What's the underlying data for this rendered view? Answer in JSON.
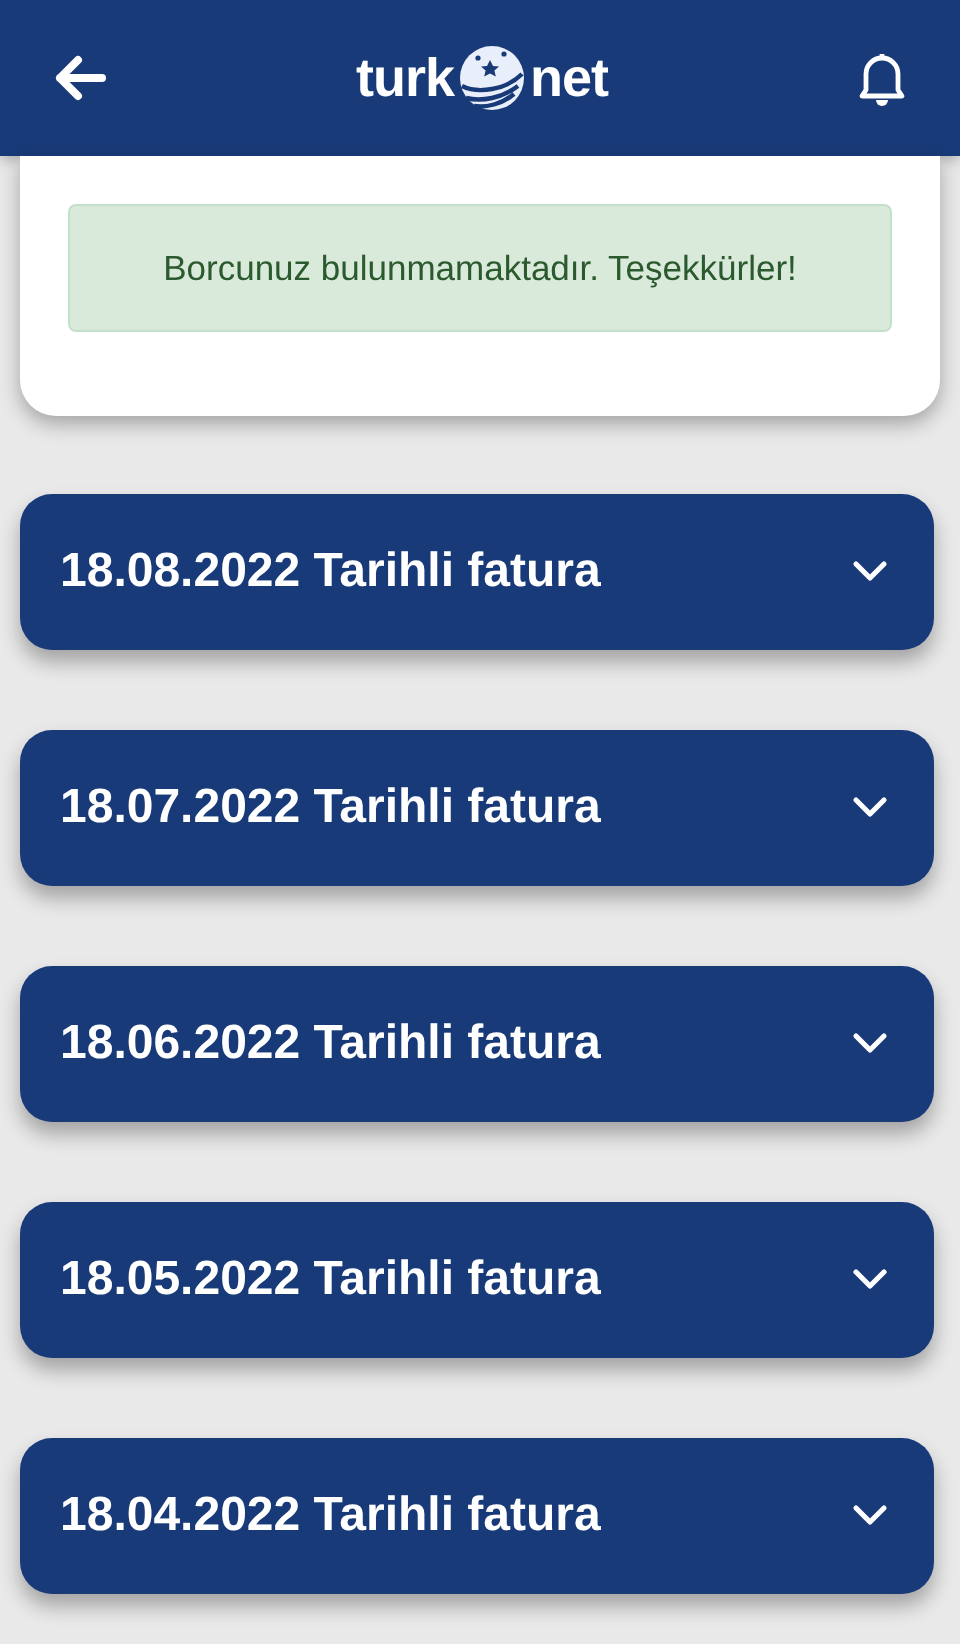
{
  "header": {
    "logo": {
      "left": "turk",
      "right": "net"
    }
  },
  "alert": {
    "text": "Borcunuz bulunmamaktadır. Teşekkürler!"
  },
  "invoices": [
    {
      "title": "18.08.2022 Tarihli fatura",
      "expanded": false
    },
    {
      "title": "18.07.2022 Tarihli fatura",
      "expanded": false
    },
    {
      "title": "18.06.2022 Tarihli fatura",
      "expanded": false
    },
    {
      "title": "18.05.2022 Tarihli fatura",
      "expanded": false
    },
    {
      "title": "18.04.2022 Tarihli fatura",
      "expanded": false
    }
  ]
}
